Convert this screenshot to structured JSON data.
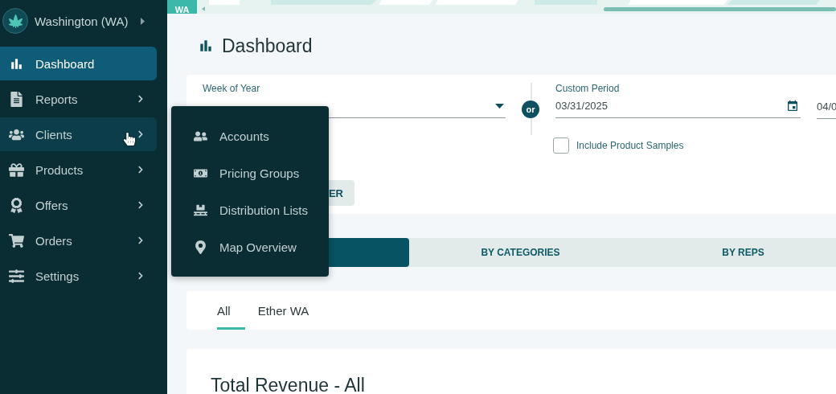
{
  "region": {
    "badge": "WA"
  },
  "sidebar": {
    "account": {
      "label": "Washington (WA)"
    },
    "items": [
      {
        "label": "Dashboard",
        "selected": true,
        "hovered": false,
        "has_children": false
      },
      {
        "label": "Reports",
        "selected": false,
        "hovered": false,
        "has_children": true
      },
      {
        "label": "Clients",
        "selected": false,
        "hovered": true,
        "has_children": true
      },
      {
        "label": "Products",
        "selected": false,
        "hovered": false,
        "has_children": true
      },
      {
        "label": "Offers",
        "selected": false,
        "hovered": false,
        "has_children": true
      },
      {
        "label": "Orders",
        "selected": false,
        "hovered": false,
        "has_children": true
      },
      {
        "label": "Settings",
        "selected": false,
        "hovered": false,
        "has_children": true
      }
    ]
  },
  "clients_menu": {
    "items": [
      {
        "label": "Accounts"
      },
      {
        "label": "Pricing Groups"
      },
      {
        "label": "Distribution Lists"
      },
      {
        "label": "Map Overview"
      }
    ]
  },
  "page": {
    "title": "Dashboard"
  },
  "filters": {
    "week": {
      "label": "Week of Year"
    },
    "separator": "or",
    "custom_period": {
      "label": "Custom Period",
      "start": "03/31/2025",
      "end": "04/0"
    },
    "include_samples": {
      "label": "Include Product Samples",
      "checked": false
    },
    "apply_button": "ER"
  },
  "view_tabs": [
    {
      "selected": true
    },
    {
      "label": "BY CATEGORIES",
      "selected": false
    },
    {
      "label": "BY REPS",
      "selected": false
    }
  ],
  "store_tabs": [
    {
      "label": "All",
      "selected": true
    },
    {
      "label": "Ether WA",
      "selected": false
    }
  ],
  "revenue_card": {
    "title": "Total Revenue - All"
  }
}
